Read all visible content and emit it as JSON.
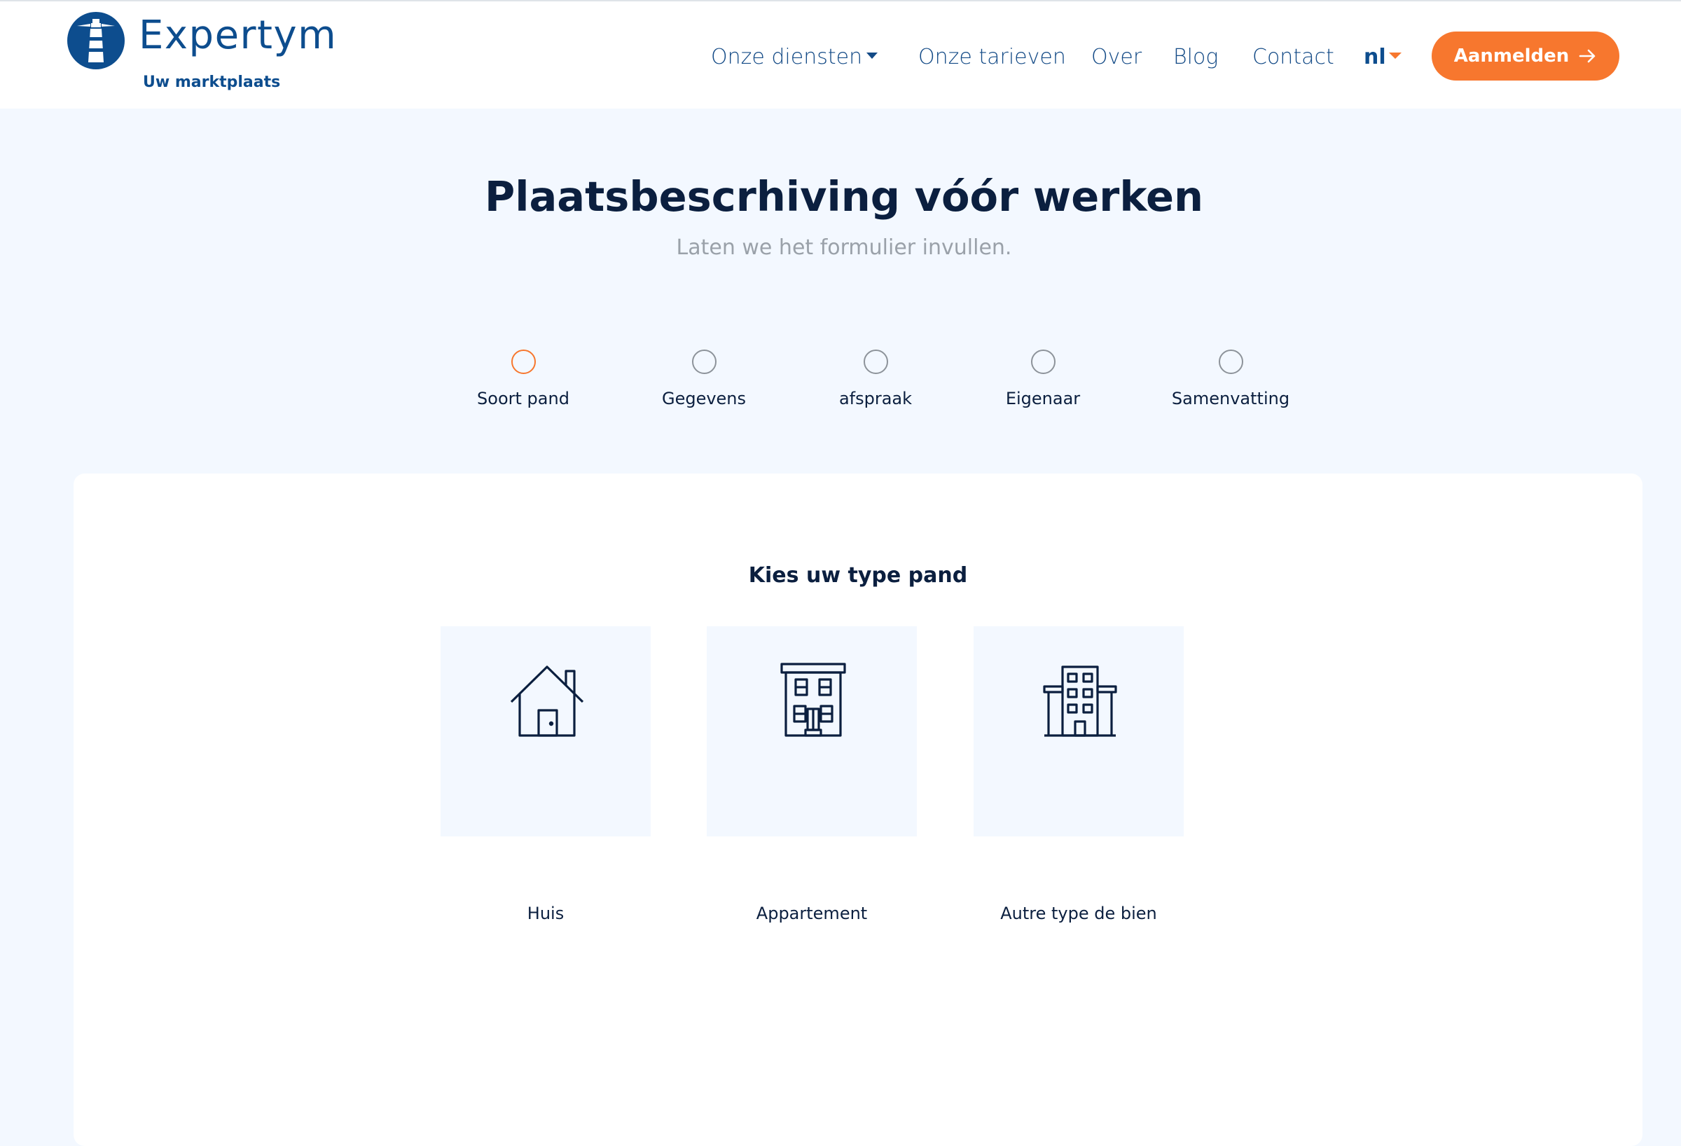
{
  "brand": {
    "name": "Expertym",
    "tagline": "Uw marktplaats",
    "color": "#0d4d8e"
  },
  "nav": {
    "items": [
      {
        "label": "Onze diensten",
        "has_dropdown": true
      },
      {
        "label": "Onze tarieven",
        "has_dropdown": false
      },
      {
        "label": "Over",
        "has_dropdown": false
      },
      {
        "label": "Blog",
        "has_dropdown": false
      },
      {
        "label": "Contact",
        "has_dropdown": false
      }
    ],
    "language": "nl",
    "cta_label": "Aanmelden",
    "cta_icon": "arrow-right-icon",
    "accent_color": "#f7772e"
  },
  "hero": {
    "title": "Plaatsbescrhiving vóór werken",
    "subtitle": "Laten we het formulier invullen."
  },
  "steps": [
    {
      "label": "Soort pand",
      "active": true
    },
    {
      "label": "Gegevens",
      "active": false
    },
    {
      "label": "afspraak",
      "active": false
    },
    {
      "label": "Eigenaar",
      "active": false
    },
    {
      "label": "Samenvatting",
      "active": false
    }
  ],
  "property_form": {
    "title": "Kies uw type pand",
    "options": [
      {
        "label": "Huis",
        "icon": "house-icon"
      },
      {
        "label": "Appartement",
        "icon": "apartment-building-icon"
      },
      {
        "label": "Autre type de bien",
        "icon": "office-building-icon"
      }
    ]
  }
}
